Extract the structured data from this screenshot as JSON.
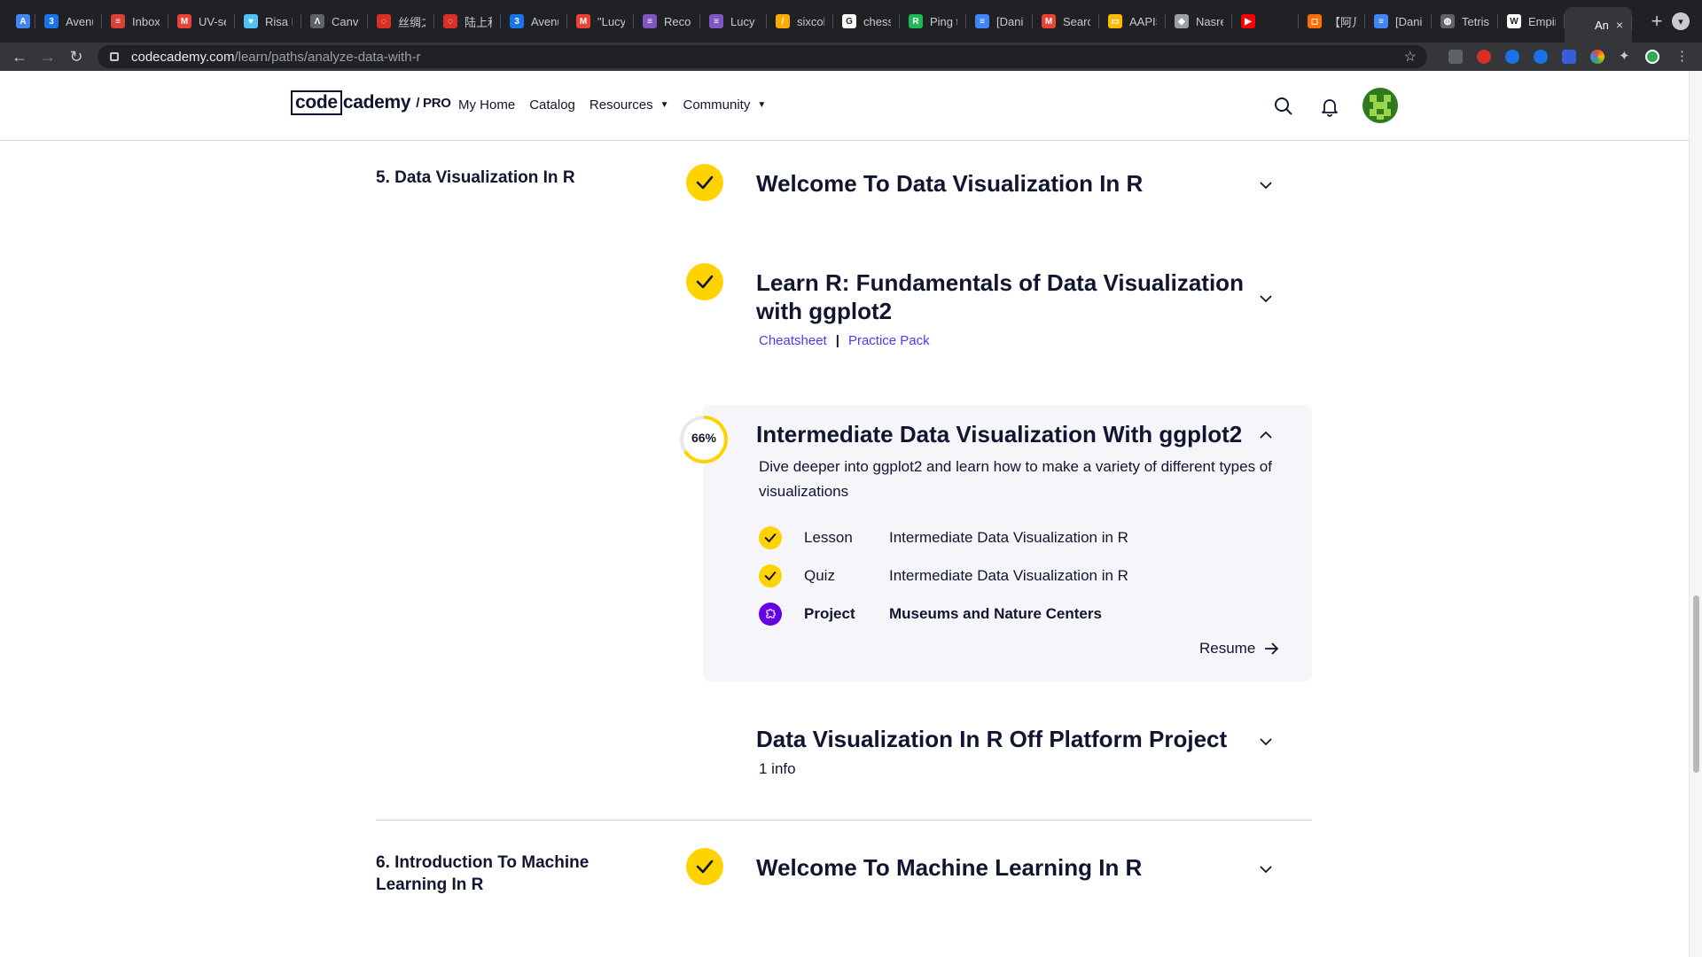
{
  "browser": {
    "tabs": [
      {
        "label": "",
        "color": "#4285f4",
        "glyph": "A"
      },
      {
        "label": "Avenue",
        "color": "#1a73e8",
        "glyph": "3"
      },
      {
        "label": "Inbox",
        "color": "#db4035",
        "glyph": "≡"
      },
      {
        "label": "UV-se",
        "color": "#ea4335",
        "glyph": "M"
      },
      {
        "label": "Risa H",
        "color": "#4fc3f7",
        "glyph": "♥"
      },
      {
        "label": "Canva",
        "color": "#5f6368",
        "glyph": "Λ"
      },
      {
        "label": "丝绸之",
        "color": "#d93025",
        "glyph": "◌"
      },
      {
        "label": "陆上和",
        "color": "#d93025",
        "glyph": "◌"
      },
      {
        "label": "Avenue",
        "color": "#1a73e8",
        "glyph": "3"
      },
      {
        "label": "\"Lucy",
        "color": "#ea4335",
        "glyph": "M"
      },
      {
        "label": "Recon",
        "color": "#7e57c2",
        "glyph": "≡"
      },
      {
        "label": "Lucy L",
        "color": "#7e57c2",
        "glyph": "≡"
      },
      {
        "label": "sixcoll",
        "color": "#f9ab00",
        "glyph": "/"
      },
      {
        "label": "chess",
        "color": "#ffffff",
        "glyph": "G"
      },
      {
        "label": "Ping t",
        "color": "#1db954",
        "glyph": "R"
      },
      {
        "label": "[Danie",
        "color": "#4285f4",
        "glyph": "≡"
      },
      {
        "label": "Search",
        "color": "#ea4335",
        "glyph": "M"
      },
      {
        "label": "AAPIS",
        "color": "#fbbc04",
        "glyph": "▭"
      },
      {
        "label": "Nasrec",
        "color": "#9aa0a6",
        "glyph": "◆"
      },
      {
        "label": "",
        "color": "#ff0000",
        "glyph": "▶"
      },
      {
        "label": "【阿凡",
        "color": "#ff6d00",
        "glyph": "◻"
      },
      {
        "label": "[Danie",
        "color": "#4285f4",
        "glyph": "≡"
      },
      {
        "label": "Tetris",
        "color": "#5f6368",
        "glyph": "◍"
      },
      {
        "label": "Empire",
        "color": "#ffffff",
        "glyph": "W"
      }
    ],
    "active_tab": {
      "label": "An",
      "close": "×"
    },
    "new_tab": "+",
    "url_host": "codecademy.com",
    "url_path": "/learn/paths/analyze-data-with-r"
  },
  "site": {
    "logo_code": "code",
    "logo_cademy": "cademy",
    "logo_pro": "/ PRO",
    "nav": [
      {
        "label": "My Home"
      },
      {
        "label": "Catalog"
      },
      {
        "label": "Resources",
        "caret": "▼"
      },
      {
        "label": "Community",
        "caret": "▼"
      }
    ]
  },
  "path": {
    "section5": {
      "title": "5. Data Visualization In R",
      "modules": {
        "m1": {
          "title": "Welcome To Data Visualization In R",
          "status": "complete"
        },
        "m2": {
          "title_line1": "Learn R: Fundamentals of Data Visualization",
          "title_line2": "with ggplot2",
          "status": "complete",
          "link_cheatsheet": "Cheatsheet",
          "link_separator": "|",
          "link_practice": "Practice Pack"
        },
        "m3": {
          "title": "Intermediate Data Visualization With ggplot2",
          "progress_label": "66%",
          "progress_fraction": 0.66,
          "description": "Dive deeper into ggplot2 and learn how to make a variety of different types of visualizations",
          "items": [
            {
              "type": "Lesson",
              "name": "Intermediate Data Visualization in R",
              "status": "complete"
            },
            {
              "type": "Quiz",
              "name": "Intermediate Data Visualization in R",
              "status": "complete"
            },
            {
              "type": "Project",
              "name": "Museums and Nature Centers",
              "status": "in-progress"
            }
          ],
          "resume_label": "Resume"
        },
        "m4": {
          "title": "Data Visualization In R Off Platform Project",
          "info": "1 info"
        }
      }
    },
    "section6": {
      "title": "6. Introduction To Machine Learning In R",
      "modules": {
        "m1": {
          "title": "Welcome To Machine Learning In R",
          "status": "complete"
        }
      }
    }
  },
  "colors": {
    "accent_yellow": "#ffd300",
    "link_purple": "#5533ff",
    "project_purple": "#6400e4",
    "navy": "#10162f"
  }
}
